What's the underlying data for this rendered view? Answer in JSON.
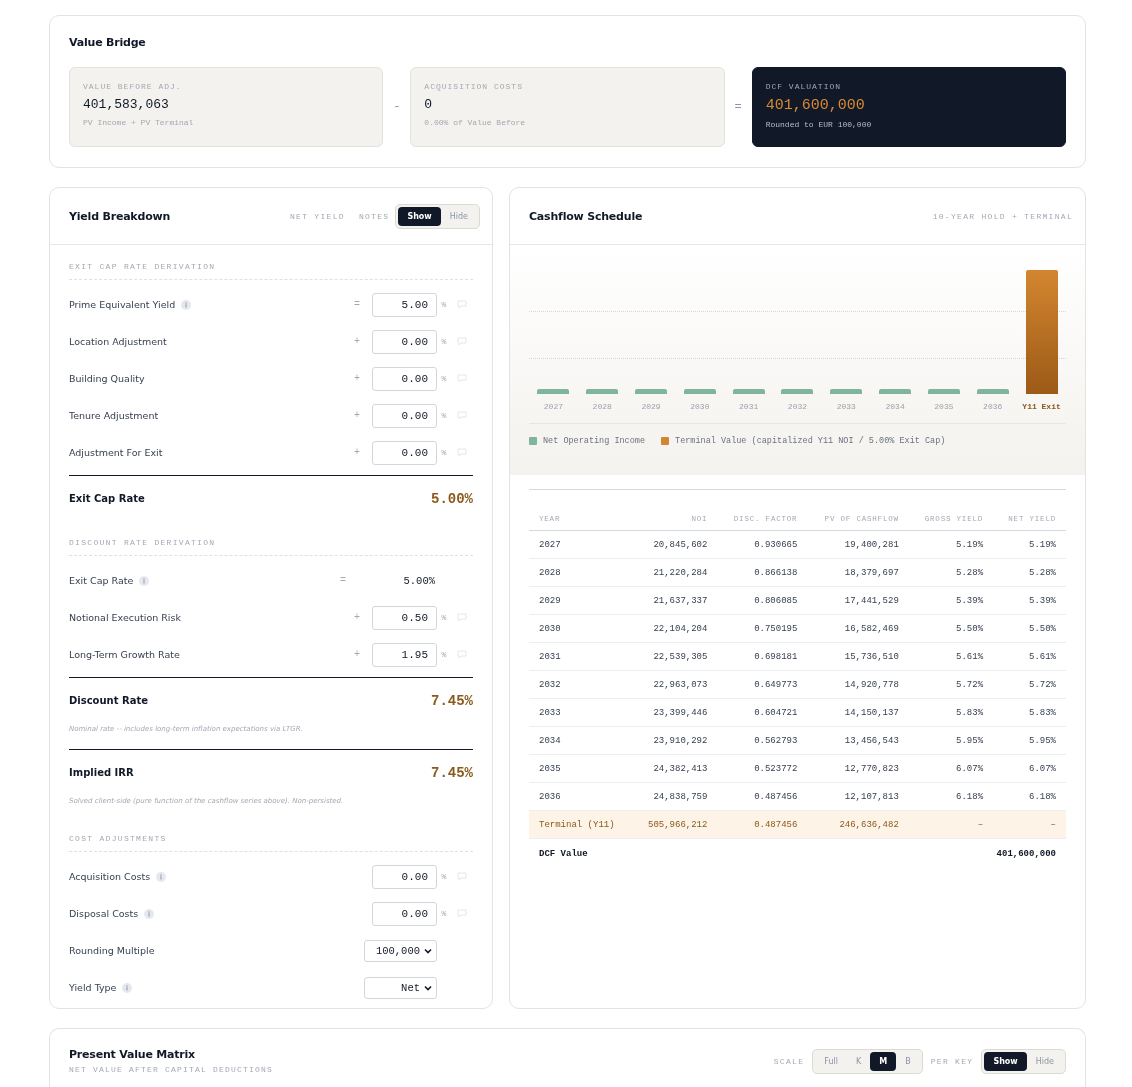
{
  "value_bridge": {
    "title": "Value Bridge",
    "cards": [
      {
        "kind": "input",
        "label": "VALUE BEFORE ADJ.",
        "value": "401,583,063",
        "caption": "PV Income + PV Terminal"
      },
      {
        "kind": "input",
        "operator": "-",
        "label": "ACQUISITION COSTS",
        "value": "0",
        "caption": "0.00% of Value Before"
      },
      {
        "kind": "result",
        "operator": "=",
        "label": "DCF VALUATION",
        "value": "401,600,000",
        "caption": "Rounded to EUR 100,000"
      }
    ]
  },
  "yield_breakdown": {
    "title": "Yield Breakdown",
    "mode_label": "NET YIELD",
    "notes_label": "NOTES",
    "notes_toggle": [
      {
        "label": "Show",
        "selected": true
      },
      {
        "label": "Hide",
        "selected": false
      }
    ],
    "rows": [
      {
        "kind": "section",
        "label": "EXIT CAP RATE DERIVATION"
      },
      {
        "kind": "input",
        "label": "Prime Equivalent Yield",
        "info": true,
        "operator": "=",
        "value": "5.00",
        "unit": "%"
      },
      {
        "kind": "input",
        "label": "Location Adjustment",
        "info": false,
        "operator": "+",
        "value": "0.00",
        "unit": "%"
      },
      {
        "kind": "input",
        "label": "Building Quality",
        "info": false,
        "operator": "+",
        "value": "0.00",
        "unit": "%"
      },
      {
        "kind": "input",
        "label": "Tenure Adjustment",
        "info": false,
        "operator": "+",
        "value": "0.00",
        "unit": "%"
      },
      {
        "kind": "input",
        "label": "Adjustment For Exit",
        "info": false,
        "operator": "+",
        "value": "0.00",
        "unit": "%"
      },
      {
        "kind": "total",
        "label": "Exit Cap Rate",
        "value": "5.00%"
      },
      {
        "kind": "section",
        "label": "DISCOUNT RATE DERIVATION"
      },
      {
        "kind": "static",
        "label": "Exit Cap Rate",
        "info": true,
        "operator": "=",
        "value": "5.00%"
      },
      {
        "kind": "input",
        "label": "Notional Execution Risk",
        "info": false,
        "operator": "+",
        "value": "0.50",
        "unit": "%"
      },
      {
        "kind": "input",
        "label": "Long-Term Growth Rate",
        "info": false,
        "operator": "+",
        "value": "1.95",
        "unit": "%"
      },
      {
        "kind": "total",
        "label": "Discount Rate",
        "value": "7.45%"
      },
      {
        "kind": "note",
        "text": "Nominal rate -- includes long-term inflation expectations via LTGR."
      },
      {
        "kind": "total",
        "label": "Implied IRR",
        "value": "7.45%"
      },
      {
        "kind": "note",
        "text": "Solved client-side (pure function of the cashflow series above). Non-persisted."
      },
      {
        "kind": "section",
        "label": "COST ADJUSTMENTS"
      },
      {
        "kind": "input",
        "label": "Acquisition Costs",
        "info": true,
        "value": "0.00",
        "unit": "%"
      },
      {
        "kind": "input",
        "label": "Disposal Costs",
        "info": true,
        "value": "0.00",
        "unit": "%"
      },
      {
        "kind": "select",
        "label": "Rounding Multiple",
        "info": false,
        "value": "100,000"
      },
      {
        "kind": "select",
        "label": "Yield Type",
        "info": true,
        "value": "Net"
      }
    ]
  },
  "cashflow": {
    "title": "Cashflow Schedule",
    "subtitle": "10-YEAR HOLD + TERMINAL",
    "chart": {
      "bars": [
        {
          "kind": "noi",
          "label": "2027"
        },
        {
          "kind": "noi",
          "label": "2028"
        },
        {
          "kind": "noi",
          "label": "2029"
        },
        {
          "kind": "noi",
          "label": "2030"
        },
        {
          "kind": "noi",
          "label": "2031"
        },
        {
          "kind": "noi",
          "label": "2032"
        },
        {
          "kind": "noi",
          "label": "2033"
        },
        {
          "kind": "noi",
          "label": "2034"
        },
        {
          "kind": "noi",
          "label": "2035"
        },
        {
          "kind": "noi",
          "label": "2036"
        },
        {
          "kind": "terminal",
          "label": "Y11 Exit"
        }
      ],
      "legend": [
        {
          "label": "Net Operating Income",
          "color": "#7fb5a0"
        },
        {
          "label": "Terminal Value (capitalized Y11 NOI / 5.00% Exit Cap)",
          "color": "#d3862f"
        }
      ]
    },
    "table": {
      "columns": [
        "YEAR",
        "NOI",
        "DISC. FACTOR",
        "PV OF CASHFLOW",
        "GROSS YIELD",
        "NET YIELD"
      ],
      "rows": [
        {
          "kind": "year",
          "cells": [
            "2027",
            "20,845,602",
            "0.930665",
            "19,400,281",
            "5.19%",
            "5.19%"
          ]
        },
        {
          "kind": "year",
          "cells": [
            "2028",
            "21,220,284",
            "0.866138",
            "18,379,697",
            "5.28%",
            "5.28%"
          ]
        },
        {
          "kind": "year",
          "cells": [
            "2029",
            "21,637,337",
            "0.806085",
            "17,441,529",
            "5.39%",
            "5.39%"
          ]
        },
        {
          "kind": "year",
          "cells": [
            "2030",
            "22,104,204",
            "0.750195",
            "16,582,469",
            "5.50%",
            "5.50%"
          ]
        },
        {
          "kind": "year",
          "cells": [
            "2031",
            "22,539,305",
            "0.698181",
            "15,736,510",
            "5.61%",
            "5.61%"
          ]
        },
        {
          "kind": "year",
          "cells": [
            "2032",
            "22,963,073",
            "0.649773",
            "14,920,778",
            "5.72%",
            "5.72%"
          ]
        },
        {
          "kind": "year",
          "cells": [
            "2033",
            "23,399,446",
            "0.604721",
            "14,150,137",
            "5.83%",
            "5.83%"
          ]
        },
        {
          "kind": "year",
          "cells": [
            "2034",
            "23,910,292",
            "0.562793",
            "13,456,543",
            "5.95%",
            "5.95%"
          ]
        },
        {
          "kind": "year",
          "cells": [
            "2035",
            "24,382,413",
            "0.523772",
            "12,770,823",
            "6.07%",
            "6.07%"
          ]
        },
        {
          "kind": "year",
          "cells": [
            "2036",
            "24,838,759",
            "0.487456",
            "12,107,813",
            "6.18%",
            "6.18%"
          ]
        },
        {
          "kind": "terminal",
          "cells": [
            "Terminal (Y11)",
            "505,966,212",
            "0.487456",
            "246,636,482",
            "–",
            "–"
          ]
        }
      ],
      "footer": {
        "label": "DCF Value",
        "value": "401,600,000"
      }
    }
  },
  "pv_matrix": {
    "title": "Present Value Matrix",
    "subtitle": "NET VALUE AFTER CAPITAL DEDUCTIONS",
    "scale_label": "SCALE",
    "scale_options": [
      {
        "label": "Full",
        "selected": false
      },
      {
        "label": "K",
        "selected": false
      },
      {
        "label": "M",
        "selected": true
      },
      {
        "label": "B",
        "selected": false
      }
    ],
    "per_key_label": "PER KEY",
    "per_key_toggle": [
      {
        "label": "Show",
        "selected": true
      },
      {
        "label": "Hide",
        "selected": false
      }
    ]
  }
}
